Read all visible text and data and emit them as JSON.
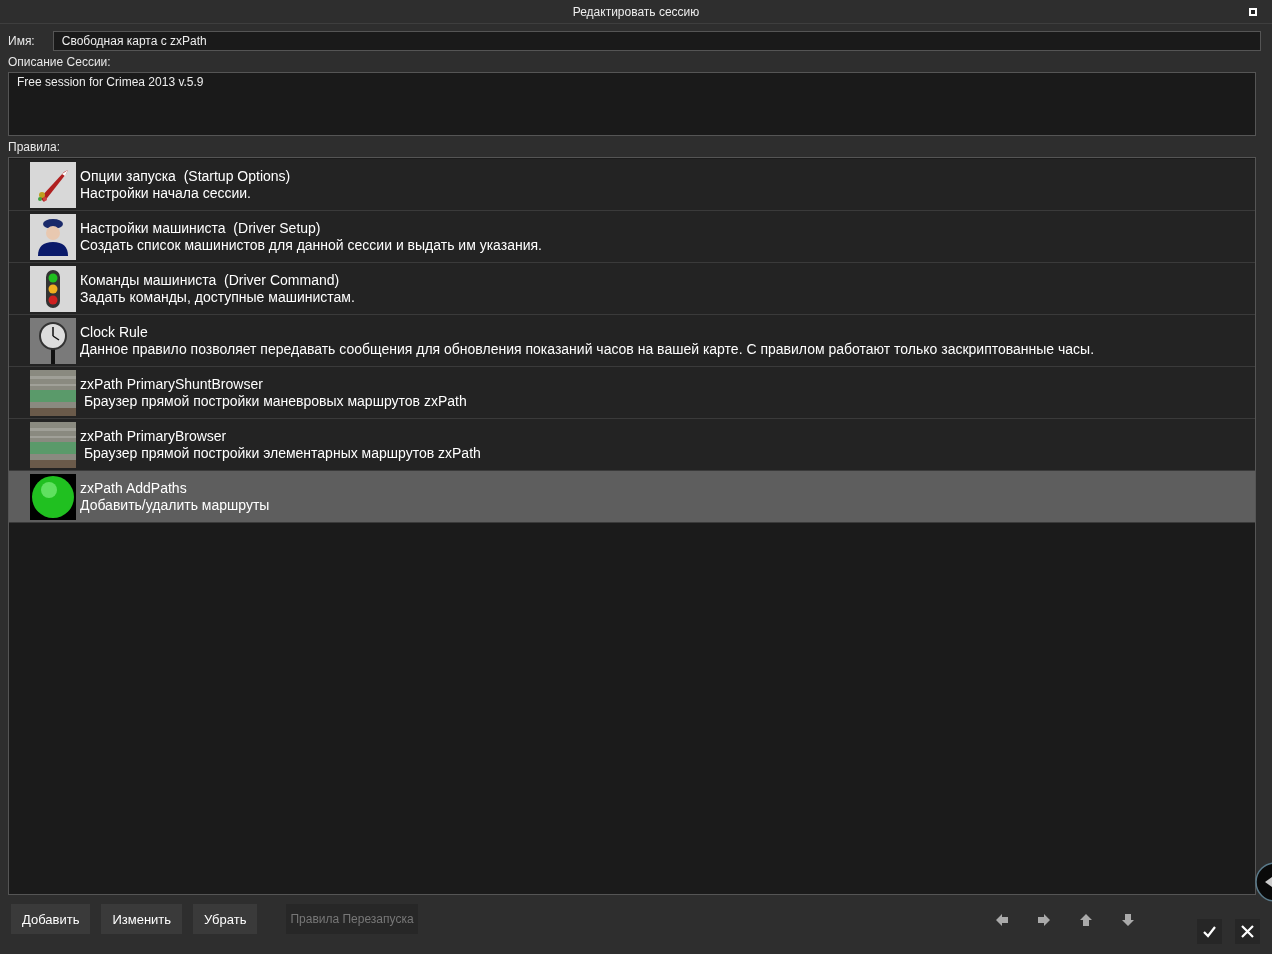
{
  "window": {
    "title": "Редактировать сессию"
  },
  "name_field": {
    "label": "Имя:",
    "value": "Свободная карта с zxPath"
  },
  "description": {
    "label": "Описание Сессии:",
    "value": "Free session for Crimea 2013 v.5.9"
  },
  "rules": {
    "label": "Правила:",
    "items": [
      {
        "kind": "rocket",
        "title": "Опции запуска  (Startup Options)",
        "subtitle": "Настройки начала сессии.",
        "selected": false
      },
      {
        "kind": "driver",
        "title": "Настройки машиниста  (Driver Setup)",
        "subtitle": "Создать список машинистов для данной сессии и выдать им указания.",
        "selected": false
      },
      {
        "kind": "signal",
        "title": "Команды машиниста  (Driver Command)",
        "subtitle": "Задать команды, доступные машинистам.",
        "selected": false
      },
      {
        "kind": "clock",
        "title": "Clock Rule",
        "subtitle": "Данное правило позволяет передавать сообщения для обновления показаний часов на вашей карте. С правилом работают только заскриптованные часы.",
        "selected": false
      },
      {
        "kind": "zxpath",
        "title": "zxPath PrimaryShuntBrowser",
        "subtitle": " Браузер прямой постройки маневровых маршрутов zxPath",
        "selected": false
      },
      {
        "kind": "zxpath",
        "title": "zxPath PrimaryBrowser",
        "subtitle": " Браузер прямой постройки элементарных маршрутов zxPath",
        "selected": false
      },
      {
        "kind": "ball",
        "title": "zxPath AddPaths",
        "subtitle": "Добавить/удалить маршруты",
        "selected": true
      }
    ]
  },
  "buttons": [
    {
      "label": "Добавить",
      "disabled": false
    },
    {
      "label": "Изменить",
      "disabled": false
    },
    {
      "label": "Убрать",
      "disabled": false
    },
    {
      "label": "Правила Перезапуска",
      "disabled": true
    }
  ]
}
